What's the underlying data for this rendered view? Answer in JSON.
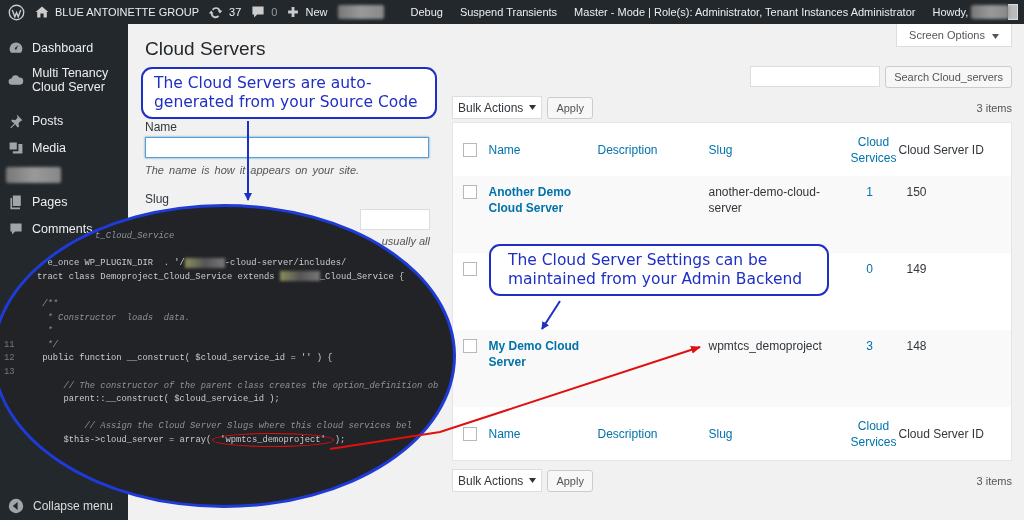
{
  "admin_bar": {
    "site": "BLUE ANTOINETTE GROUP",
    "updates": "37",
    "comments": "0",
    "new": "New",
    "right": [
      "Debug",
      "Suspend Transients",
      "Master - Mode | Role(s): Administrator, Tenant Instances Administrator"
    ],
    "howdy": "Howdy,"
  },
  "sidebar": {
    "groups": [
      [
        {
          "kind": "item",
          "label": "Dashboard"
        },
        {
          "kind": "item",
          "label": "Multi Tenancy Cloud Server"
        }
      ],
      [
        {
          "kind": "item",
          "label": "Posts"
        },
        {
          "kind": "item",
          "label": "Media"
        },
        {
          "kind": "redacted"
        },
        {
          "kind": "item",
          "label": "Pages"
        },
        {
          "kind": "item",
          "label": "Comments"
        }
      ]
    ],
    "collapse": "Collapse menu"
  },
  "page": {
    "title": "Cloud Servers",
    "screen_options": "Screen Options"
  },
  "form": {
    "name_label": "Name",
    "name_focused": true,
    "name_hint": "The name is how it appears on your site.",
    "slug_label": "Slug",
    "slug_hint": "usually all"
  },
  "search": {
    "button": "Search Cloud_servers"
  },
  "bulk": [
    {
      "label": "Bulk Actions",
      "apply": "Apply",
      "count": "3 items"
    },
    {
      "label": "Bulk Actions",
      "apply": "Apply",
      "count": "3 items"
    }
  ],
  "table": {
    "select_all_checked": false,
    "columns": [
      {
        "label": "Name",
        "sortable": true
      },
      {
        "label": "Description",
        "sortable": true
      },
      {
        "label": "Slug",
        "sortable": true
      },
      {
        "label": "Cloud Services",
        "sortable": true
      },
      {
        "label": "Cloud Server ID",
        "sortable": false
      }
    ],
    "rows": [
      {
        "checked": false,
        "name": "Another Demo Cloud Server",
        "slug": "another-demo-cloud-server",
        "services": "1",
        "id": "150"
      },
      {
        "checked": false,
        "services": "0",
        "id": "149"
      },
      {
        "checked": false,
        "name": "My Demo Cloud Server",
        "slug": "wpmtcs_demoproject",
        "services": "3",
        "id": "148"
      }
    ],
    "footer_checked": false,
    "footer_columns": [
      {
        "label": "Name",
        "sortable": true
      },
      {
        "label": "Description",
        "sortable": true
      },
      {
        "label": "Slug",
        "sortable": true
      },
      {
        "label": "Cloud Services",
        "sortable": true
      },
      {
        "label": "Cloud Server ID",
        "sortable": false
      }
    ]
  },
  "callouts": [
    {
      "text": "The Cloud Servers are auto-generated from your Source Code"
    },
    {
      "text": "The Cloud Server Settings can be maintained from your Admin Backend"
    }
  ],
  "code_inset": {
    "lines": [
      {
        "kind": "comment",
        "parts": [
          "           t_Cloud_Service"
        ]
      },
      {
        "kind": "blank"
      },
      {
        "kind": "code",
        "parts": [
          "  e_once WP_PLUGIN_DIR  . '/",
          {
            "kind": "redacted"
          },
          "-cloud-server/includes/"
        ]
      },
      {
        "kind": "code",
        "parts": [
          "tract class Demoproject_Cloud_Service extends ",
          {
            "kind": "redacted"
          },
          "_Cloud_Service {"
        ]
      },
      {
        "kind": "blank"
      },
      {
        "kind": "comment",
        "parts": [
          " /**"
        ]
      },
      {
        "kind": "comment",
        "parts": [
          "  * Constructor  loads  data."
        ]
      },
      {
        "kind": "comment",
        "parts": [
          "  *"
        ]
      },
      {
        "kind": "comment",
        "number": "11",
        "parts": [
          "  */"
        ]
      },
      {
        "kind": "code",
        "number": "12",
        "parts": [
          " public function __construct( $cloud_service_id = '' ) {"
        ]
      },
      {
        "kind": "blank",
        "number": "13"
      },
      {
        "kind": "comment",
        "parts": [
          "     // The constructor of the parent class creates the option_definition ob"
        ]
      },
      {
        "kind": "code",
        "parts": [
          "     parent::__construct( $cloud_service_id );"
        ]
      },
      {
        "kind": "blank"
      },
      {
        "kind": "comment",
        "parts": [
          "         // Assign the Cloud Server Slugs where this cloud services bel"
        ]
      },
      {
        "kind": "code",
        "parts": [
          "     $this->cloud_server = array(",
          {
            "kind": "highlighted",
            "text": "'wpmtcs_demoproject'"
          },
          ");"
        ]
      }
    ]
  }
}
